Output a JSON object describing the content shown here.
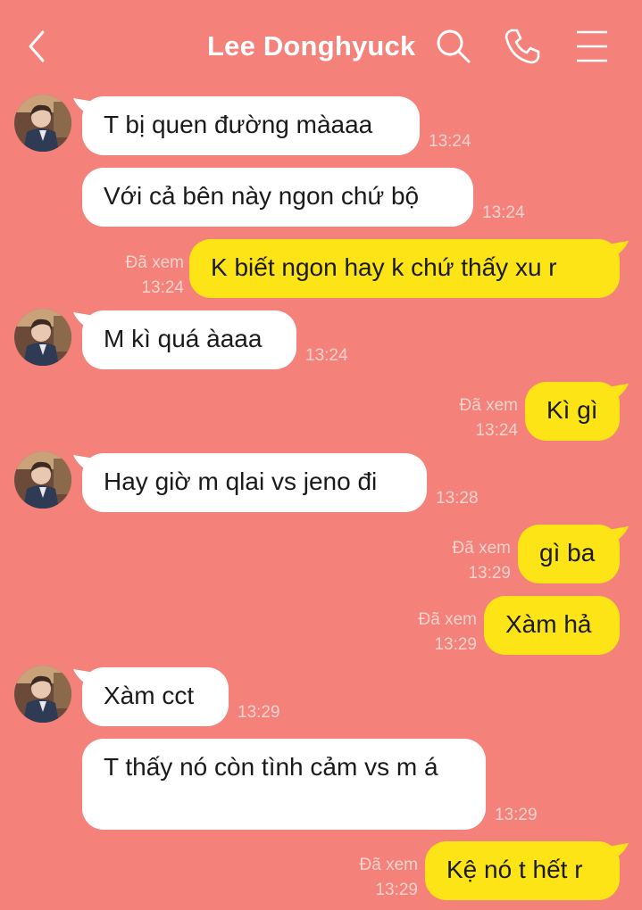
{
  "header": {
    "title": "Lee Donghyuck"
  },
  "colors": {
    "background": "#f4817a",
    "incoming_bubble": "#ffffff",
    "outgoing_bubble": "#fde416",
    "meta_text": "#fbd4cf"
  },
  "icons": {
    "back": "chevron-left-icon",
    "search": "search-icon",
    "call": "phone-icon",
    "menu": "hamburger-menu-icon"
  },
  "messages": [
    {
      "direction": "in",
      "text": "T bị quen đường màaaa",
      "time": "13:24",
      "avatar": true
    },
    {
      "direction": "in",
      "text": "Với cả bên này ngon chứ bộ",
      "time": "13:24",
      "avatar": false
    },
    {
      "direction": "out",
      "text": "K biết ngon hay k chứ thấy xu r",
      "time": "13:24",
      "status": "Đã xem"
    },
    {
      "direction": "in",
      "text": "M kì quá àaaa",
      "time": "13:24",
      "avatar": true
    },
    {
      "direction": "out",
      "text": "Kì gì",
      "time": "13:24",
      "status": "Đã xem"
    },
    {
      "direction": "in",
      "text": "Hay giờ m qlai vs jeno đi",
      "time": "13:28",
      "avatar": true
    },
    {
      "direction": "out",
      "text": "gì ba",
      "time": "13:29",
      "status": "Đã xem"
    },
    {
      "direction": "out",
      "text": "Xàm hả",
      "time": "13:29",
      "status": "Đã xem"
    },
    {
      "direction": "in",
      "text": "Xàm cct",
      "time": "13:29",
      "avatar": true
    },
    {
      "direction": "in",
      "text": "T thấy nó còn tình cảm vs m á",
      "time": "13:29",
      "avatar": false
    },
    {
      "direction": "out",
      "text": "Kệ nó t hết r",
      "time": "13:29",
      "status": "Đã xem"
    }
  ]
}
